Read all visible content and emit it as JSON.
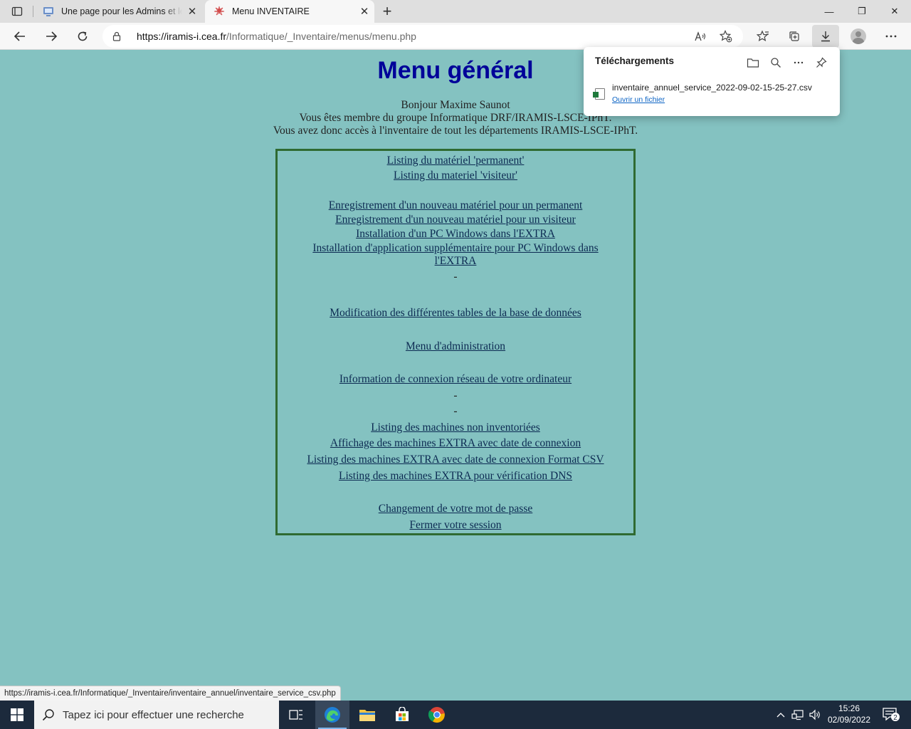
{
  "browser": {
    "tabs": [
      {
        "title": "Une page pour les Admins et les",
        "favicon": "admin-page-icon",
        "active": false
      },
      {
        "title": "Menu INVENTAIRE",
        "favicon": "iramis-logo-icon",
        "active": true
      }
    ],
    "url_host": "https://iramis-i.cea.fr",
    "url_path": "/Informatique/_Inventaire/menus/menu.php",
    "window_controls": {
      "minimize": "—",
      "restore": "❐",
      "close": "✕"
    }
  },
  "page": {
    "title": "Menu général",
    "welcome": [
      "Bonjour Maxime Saunot",
      "Vous êtes membre du groupe Informatique DRF/IRAMIS-LSCE-IPhT.",
      "Vous avez donc accès à l'inventaire de tout les départements IRAMIS-LSCE-IPhT."
    ],
    "menu": [
      {
        "type": "link",
        "text": "Listing du matériel 'permanent'"
      },
      {
        "type": "link",
        "text": "Listing du materiel 'visiteur'"
      },
      {
        "type": "link",
        "text": "Enregistrement d'un nouveau matériel pour un permanent"
      },
      {
        "type": "link",
        "text": "Enregistrement d'un nouveau matériel pour un visiteur"
      },
      {
        "type": "link",
        "text": "Installation d'un PC Windows dans l'EXTRA"
      },
      {
        "type": "link",
        "text": "Installation d'application supplémentaire pour PC Windows dans",
        "text2": "l'EXTRA"
      },
      {
        "type": "dash",
        "text": "-"
      },
      {
        "type": "link",
        "text": "Modification des différentes tables de la base de données"
      },
      {
        "type": "link",
        "text": "Menu d'administration"
      },
      {
        "type": "link",
        "text": "Information de connexion réseau de votre ordinateur"
      },
      {
        "type": "dash",
        "text": "-"
      },
      {
        "type": "dash",
        "text": "-"
      },
      {
        "type": "link",
        "text": "Listing des machines non inventoriées"
      },
      {
        "type": "link",
        "text": "Affichage des machines EXTRA avec date de connexion"
      },
      {
        "type": "link",
        "text": "Listing des machines EXTRA avec date de connexion Format CSV"
      },
      {
        "type": "link",
        "text": "Listing des machines EXTRA pour vérification DNS"
      },
      {
        "type": "link",
        "text": "Changement de votre mot de passe"
      },
      {
        "type": "link",
        "text": "Fermer votre session"
      }
    ]
  },
  "downloads": {
    "title": "Téléchargements",
    "file": "inventaire_annuel_service_2022-09-02-15-25-27.csv",
    "open_label": "Ouvrir un fichier"
  },
  "status_url": "https://iramis-i.cea.fr/Informatique/_Inventaire/inventaire_annuel/inventaire_service_csv.php",
  "taskbar": {
    "search_placeholder": "Tapez ici pour effectuer une recherche",
    "time": "15:26",
    "date": "02/09/2022",
    "notifications": "2"
  },
  "colors": {
    "page_bg": "#84c2c1",
    "title": "#000099",
    "menu_border": "#2f6a31",
    "link": "#0c2a52"
  }
}
